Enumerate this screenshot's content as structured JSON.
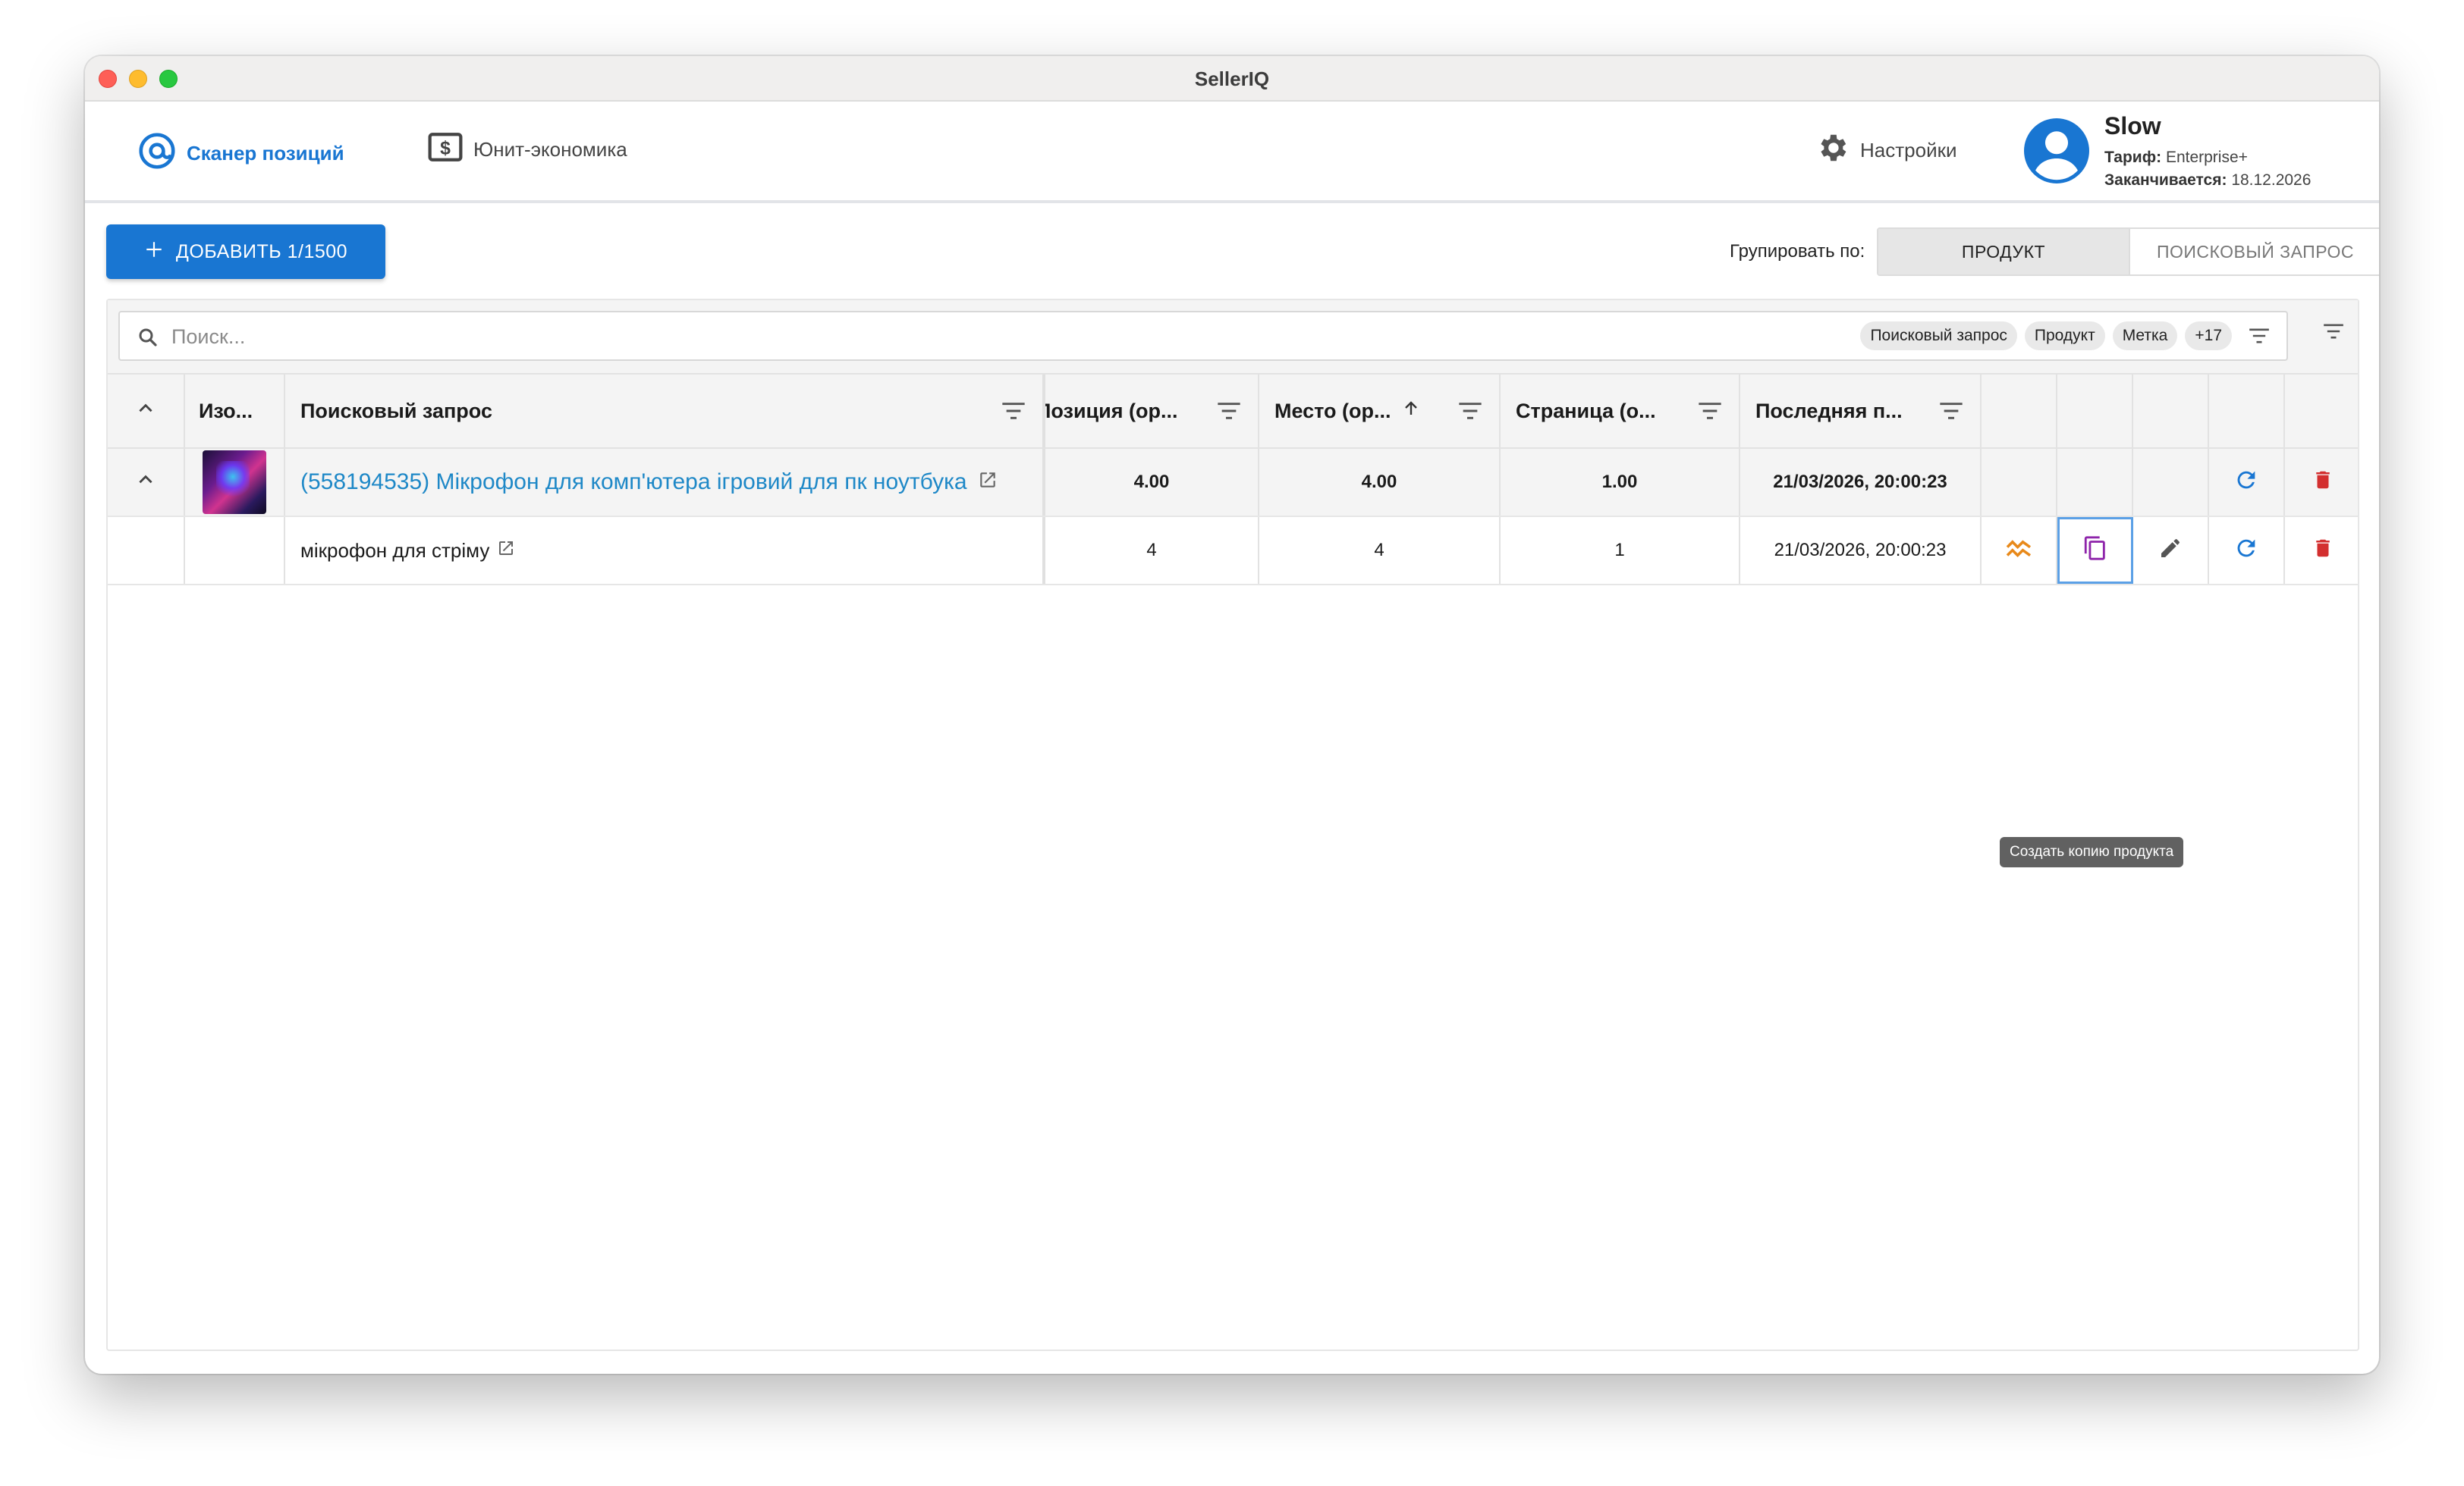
{
  "window": {
    "title": "SellerIQ"
  },
  "nav": {
    "scanner_label": "Сканер позиций",
    "unit_label": "Юнит-экономика",
    "settings_label": "Настройки"
  },
  "profile": {
    "name": "Slow",
    "plan_label": "Тариф:",
    "plan_value": "Enterprise+",
    "expires_label": "Заканчивается:",
    "expires_value": "18.12.2026"
  },
  "toolbar": {
    "add_label": "ДОБАВИТЬ 1/1500",
    "group_label": "Групировать по:",
    "group_options": [
      "ПРОДУКТ",
      "ПОИСКОВЫЙ ЗАПРОС"
    ],
    "group_selected": "ПРОДУКТ"
  },
  "search": {
    "placeholder": "Поиск...",
    "chips": [
      "Поисковый запрос",
      "Продукт",
      "Метка",
      "+17"
    ]
  },
  "table": {
    "headers": {
      "image": "Изо...",
      "query": "Поисковый запрос",
      "position": "Позиция (ор...",
      "place": "Место (ор...",
      "page": "Страница (о...",
      "last": "Последняя п..."
    },
    "group_row": {
      "product": "(558194535) Мікрофон для комп'ютера ігровий для пк ноутбука",
      "position": "4.00",
      "place": "4.00",
      "page": "1.00",
      "last": "21/03/2026, 20:00:23"
    },
    "rows": [
      {
        "query": "мікрофон для стріму",
        "position": "4",
        "place": "4",
        "page": "1",
        "last": "21/03/2026, 20:00:23"
      }
    ]
  },
  "tooltip": {
    "text": "Создать копию продукта"
  },
  "colors": {
    "primary": "#1976d2",
    "link": "#1e88c7",
    "danger": "#d32f2f",
    "chart_orange": "#e8891a",
    "copy_purple": "#8e24aa"
  }
}
